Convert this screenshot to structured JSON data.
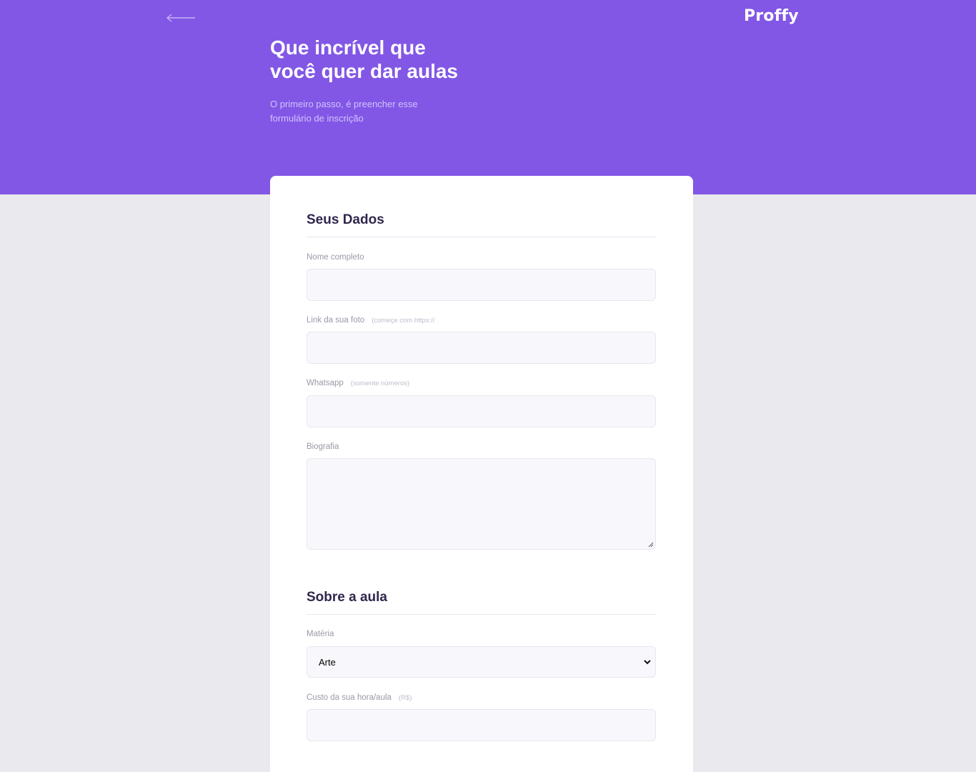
{
  "header": {
    "back_icon": "arrow-left-icon",
    "logo_text": "Proffy",
    "title_line1": "Que incrível que",
    "title_line2": "você quer dar aulas",
    "description_line1": "O primeiro passo, é preencher esse",
    "description_line2": "formulário de inscrição"
  },
  "form": {
    "section_personal": {
      "title": "Seus Dados",
      "name_label": "Nome completo",
      "name_value": "",
      "avatar_label": "Link da sua foto",
      "avatar_hint": "(começe com https://",
      "avatar_value": "",
      "whatsapp_label": "Whatsapp",
      "whatsapp_hint": "(somente números)",
      "whatsapp_value": "",
      "bio_label": "Biografia",
      "bio_value": ""
    },
    "section_class": {
      "title": "Sobre a aula",
      "subject_label": "Matéria",
      "subject_selected": "Arte",
      "cost_label": "Custo da sua hora/aula",
      "cost_hint": "(R$)",
      "cost_value": ""
    }
  },
  "colors": {
    "primary": "#8257e5",
    "background": "#e9e9ee",
    "card": "#ffffff",
    "input_bg": "#f8f8fc",
    "title_text": "#32264d",
    "label_text": "#9c98a6"
  }
}
